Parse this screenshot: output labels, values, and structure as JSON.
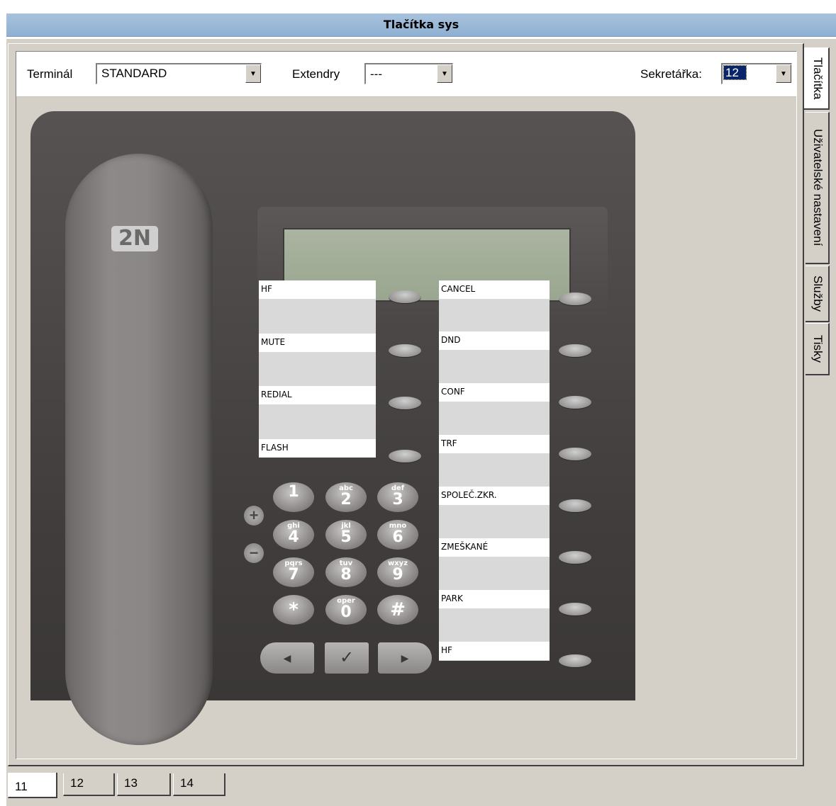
{
  "window": {
    "title": "Tlačítka sys"
  },
  "toolbar": {
    "terminal_label": "Terminál",
    "terminal_value": "STANDARD",
    "extendry_label": "Extendry",
    "extendry_value": "---",
    "sekretarka_label": "Sekretářka:",
    "sekretarka_value": "12"
  },
  "phone": {
    "logo": "2N",
    "left_keys": [
      "HF",
      "MUTE",
      "REDIAL",
      "FLASH"
    ],
    "right_keys": [
      "CANCEL",
      "DND",
      "CONF",
      "TRF",
      "SPOLEČ.ZKR.",
      "ZMEŠKANÉ",
      "PARK",
      "HF"
    ],
    "keypad": [
      {
        "num": "1",
        "sub": ""
      },
      {
        "num": "2",
        "sub": "abc"
      },
      {
        "num": "3",
        "sub": "def"
      },
      {
        "num": "4",
        "sub": "ghi"
      },
      {
        "num": "5",
        "sub": "jkl"
      },
      {
        "num": "6",
        "sub": "mno"
      },
      {
        "num": "7",
        "sub": "pqrs"
      },
      {
        "num": "8",
        "sub": "tuv"
      },
      {
        "num": "9",
        "sub": "wxyz"
      },
      {
        "num": "*",
        "sub": ""
      },
      {
        "num": "0",
        "sub": "oper"
      },
      {
        "num": "#",
        "sub": ""
      }
    ],
    "vol_up": "+",
    "vol_down": "−"
  },
  "side_tabs": [
    "Tlačítka",
    "Uživatelské nastavení",
    "Služby",
    "Tisky"
  ],
  "bottom_tabs": [
    "11",
    "12",
    "13",
    "14"
  ]
}
